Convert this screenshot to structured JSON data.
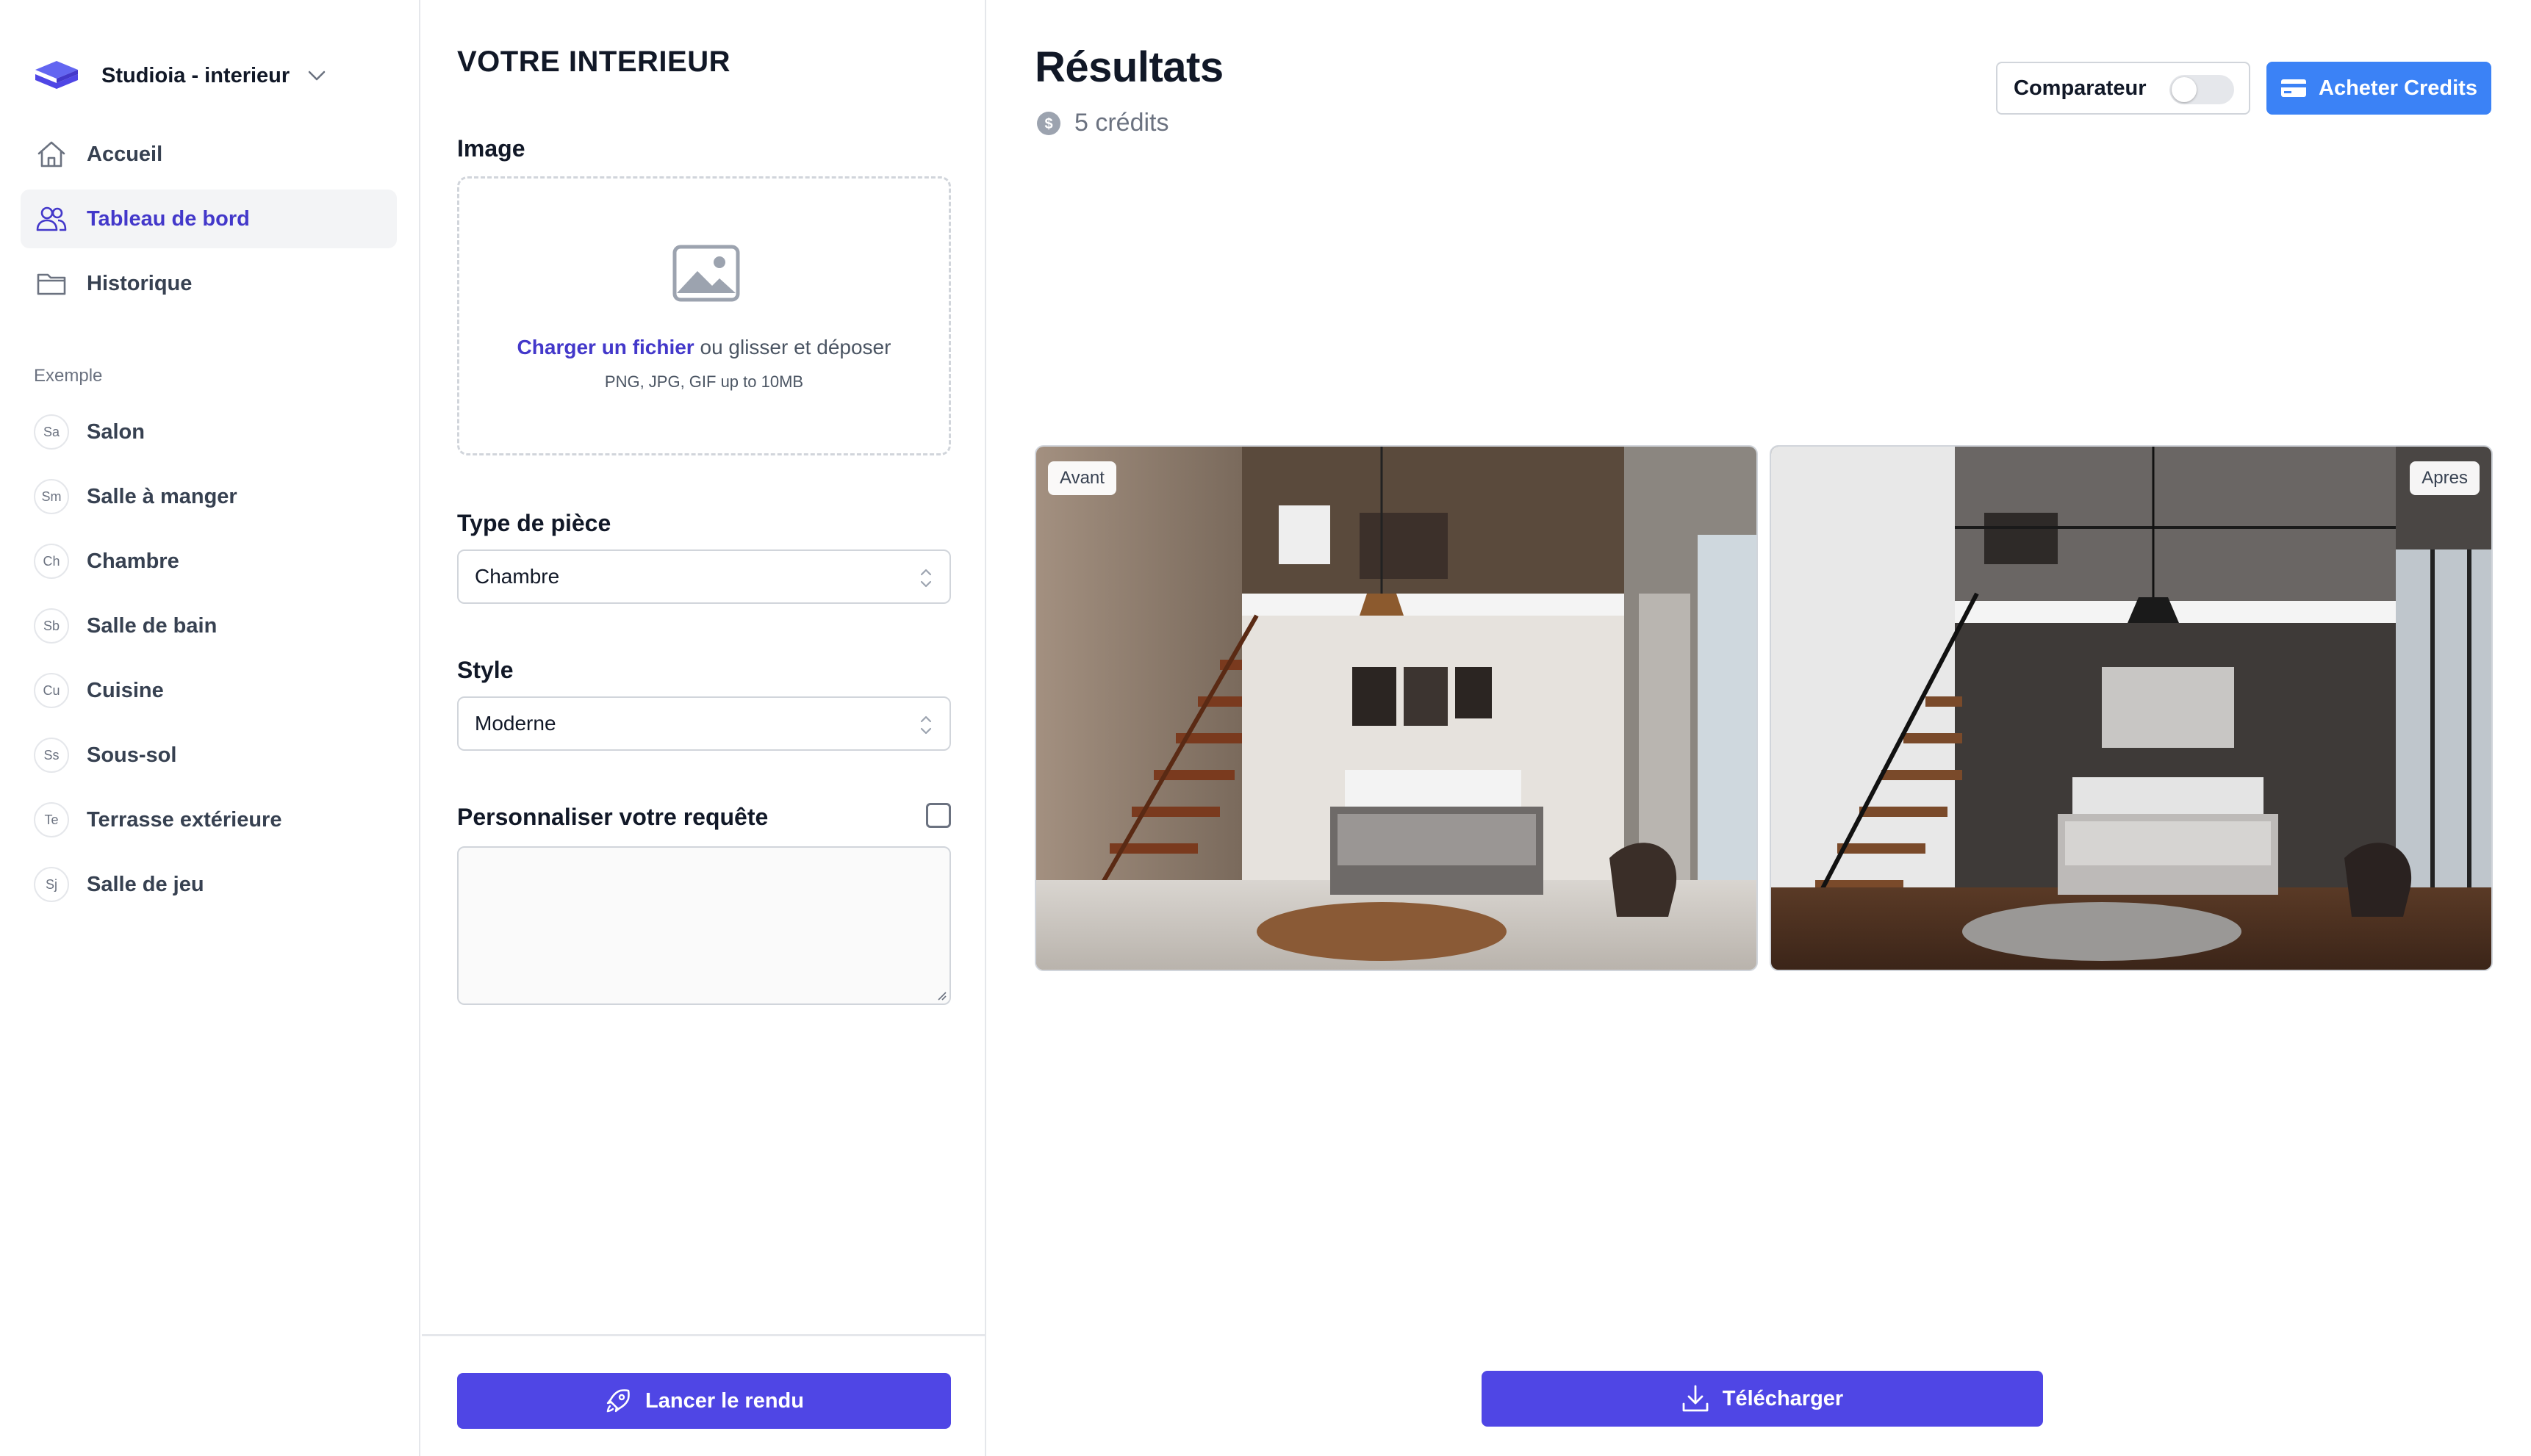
{
  "brand": {
    "name": "Studioia - interieur",
    "logo_icon": "layers-icon",
    "color": "#4f46e5"
  },
  "nav": [
    {
      "label": "Accueil",
      "icon": "home-icon",
      "active": false
    },
    {
      "label": "Tableau de bord",
      "icon": "users-icon",
      "active": true
    },
    {
      "label": "Historique",
      "icon": "folder-icon",
      "active": false
    }
  ],
  "examples": {
    "title": "Exemple",
    "items": [
      {
        "abbr": "Sa",
        "label": "Salon"
      },
      {
        "abbr": "Sm",
        "label": "Salle à manger"
      },
      {
        "abbr": "Ch",
        "label": "Chambre"
      },
      {
        "abbr": "Sb",
        "label": "Salle de bain"
      },
      {
        "abbr": "Cu",
        "label": "Cuisine"
      },
      {
        "abbr": "Ss",
        "label": "Sous-sol"
      },
      {
        "abbr": "Te",
        "label": "Terrasse extérieure"
      },
      {
        "abbr": "Sj",
        "label": "Salle de jeu"
      }
    ]
  },
  "form": {
    "title": "VOTRE INTERIEUR",
    "image_label": "Image",
    "upload_link": "Charger un fichier",
    "upload_text": " ou glisser et déposer",
    "upload_hint": "PNG, JPG, GIF up to 10MB",
    "room_type_label": "Type de pièce",
    "room_type_value": "Chambre",
    "style_label": "Style",
    "style_value": "Moderne",
    "custom_label": "Personnaliser votre requête",
    "custom_checked": false,
    "custom_value": "",
    "submit_label": "Lancer le rendu"
  },
  "results": {
    "title": "Résultats",
    "credits": "5 crédits",
    "comparator_label": "Comparateur",
    "comparator_on": false,
    "buy_label": "Acheter Credits",
    "before_tag": "Avant",
    "after_tag": "Apres",
    "download_label": "Télécharger"
  },
  "colors": {
    "primary": "#4f46e5",
    "buy_button": "#3b82f6",
    "active_text": "#4338ca"
  }
}
